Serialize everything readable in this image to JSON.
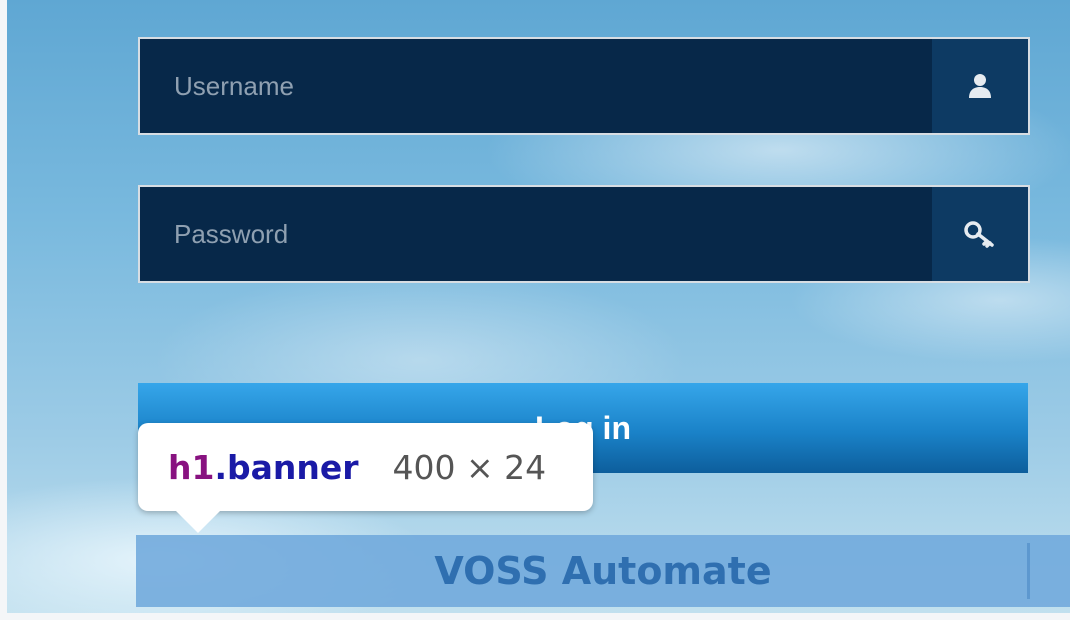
{
  "login_form": {
    "username_placeholder": "Username",
    "password_placeholder": "Password",
    "username_icon": "user-icon",
    "password_icon": "key-icon",
    "login_label": "Log in"
  },
  "banner": {
    "title": "VOSS Automate"
  },
  "inspector_tooltip": {
    "tag": "h1",
    "class_name": ".banner",
    "dimensions": "400 × 24"
  },
  "colors": {
    "field_bg": "#072849",
    "addon_bg": "#0d3a63",
    "button_gradient_top": "#36a6ea",
    "button_gradient_bottom": "#0d5e9c",
    "banner_text": "#2f6fb0",
    "highlight_overlay": "#6fa8dc"
  }
}
